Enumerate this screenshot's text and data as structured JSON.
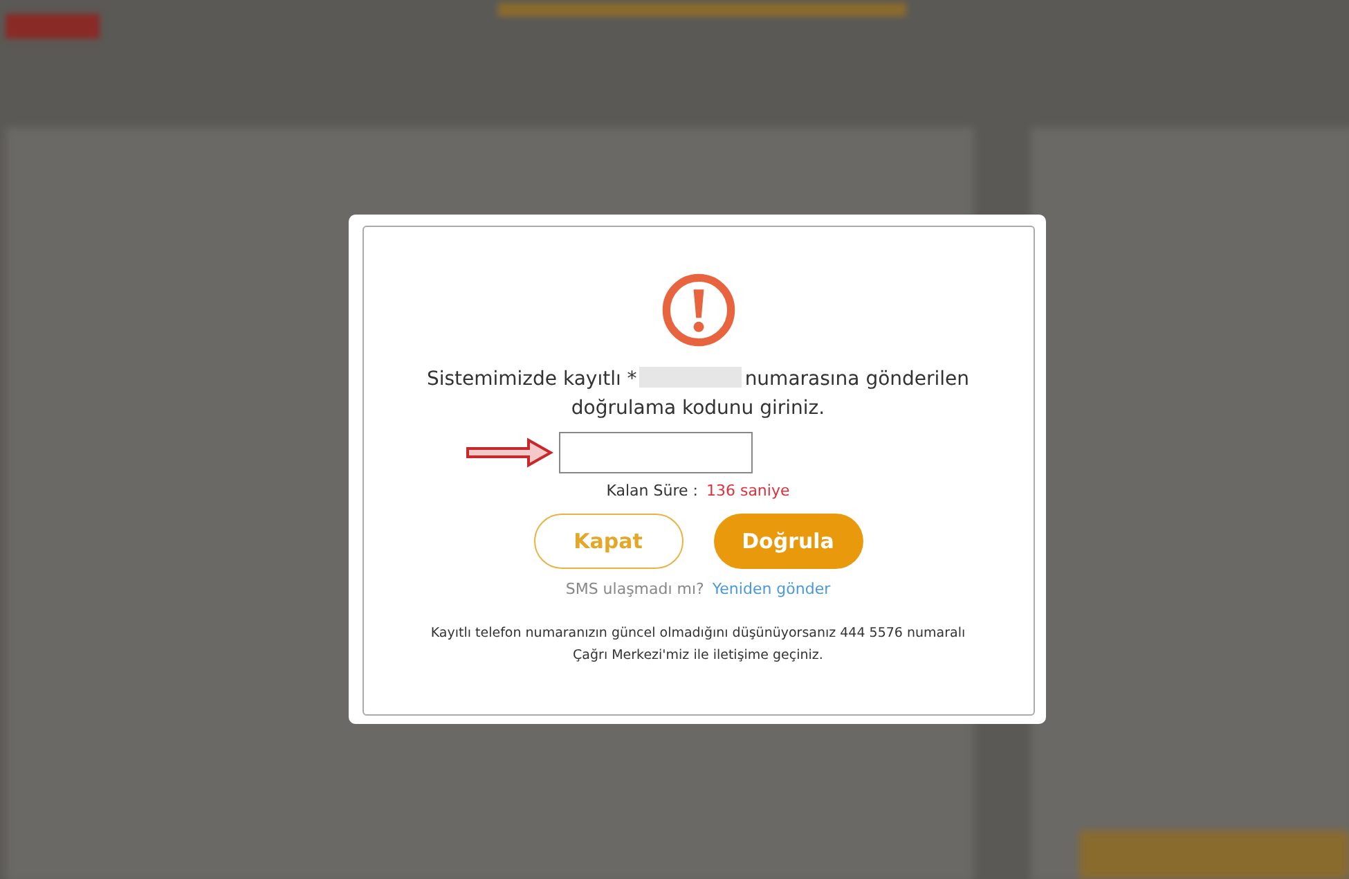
{
  "dialog": {
    "message_start": "Sistemimizde kayıtlı *",
    "message_end": "numarasına gönderilen doğrulama kodunu giriniz.",
    "timer": {
      "label": "Kalan Süre :",
      "value": "136 saniye"
    },
    "buttons": [
      {
        "label": "Kapat",
        "kind": "outline"
      },
      {
        "label": "Doğrula",
        "kind": "filled"
      }
    ],
    "resend": {
      "question": "SMS ulaşmadı mı?",
      "link": "Yeniden gönder"
    },
    "footer": "Kayıtlı telefon numaranızın güncel olmadığını düşünüyorsanız 444 5576 numaralı Çağrı Merkezi'miz ile iletişime geçiniz."
  }
}
